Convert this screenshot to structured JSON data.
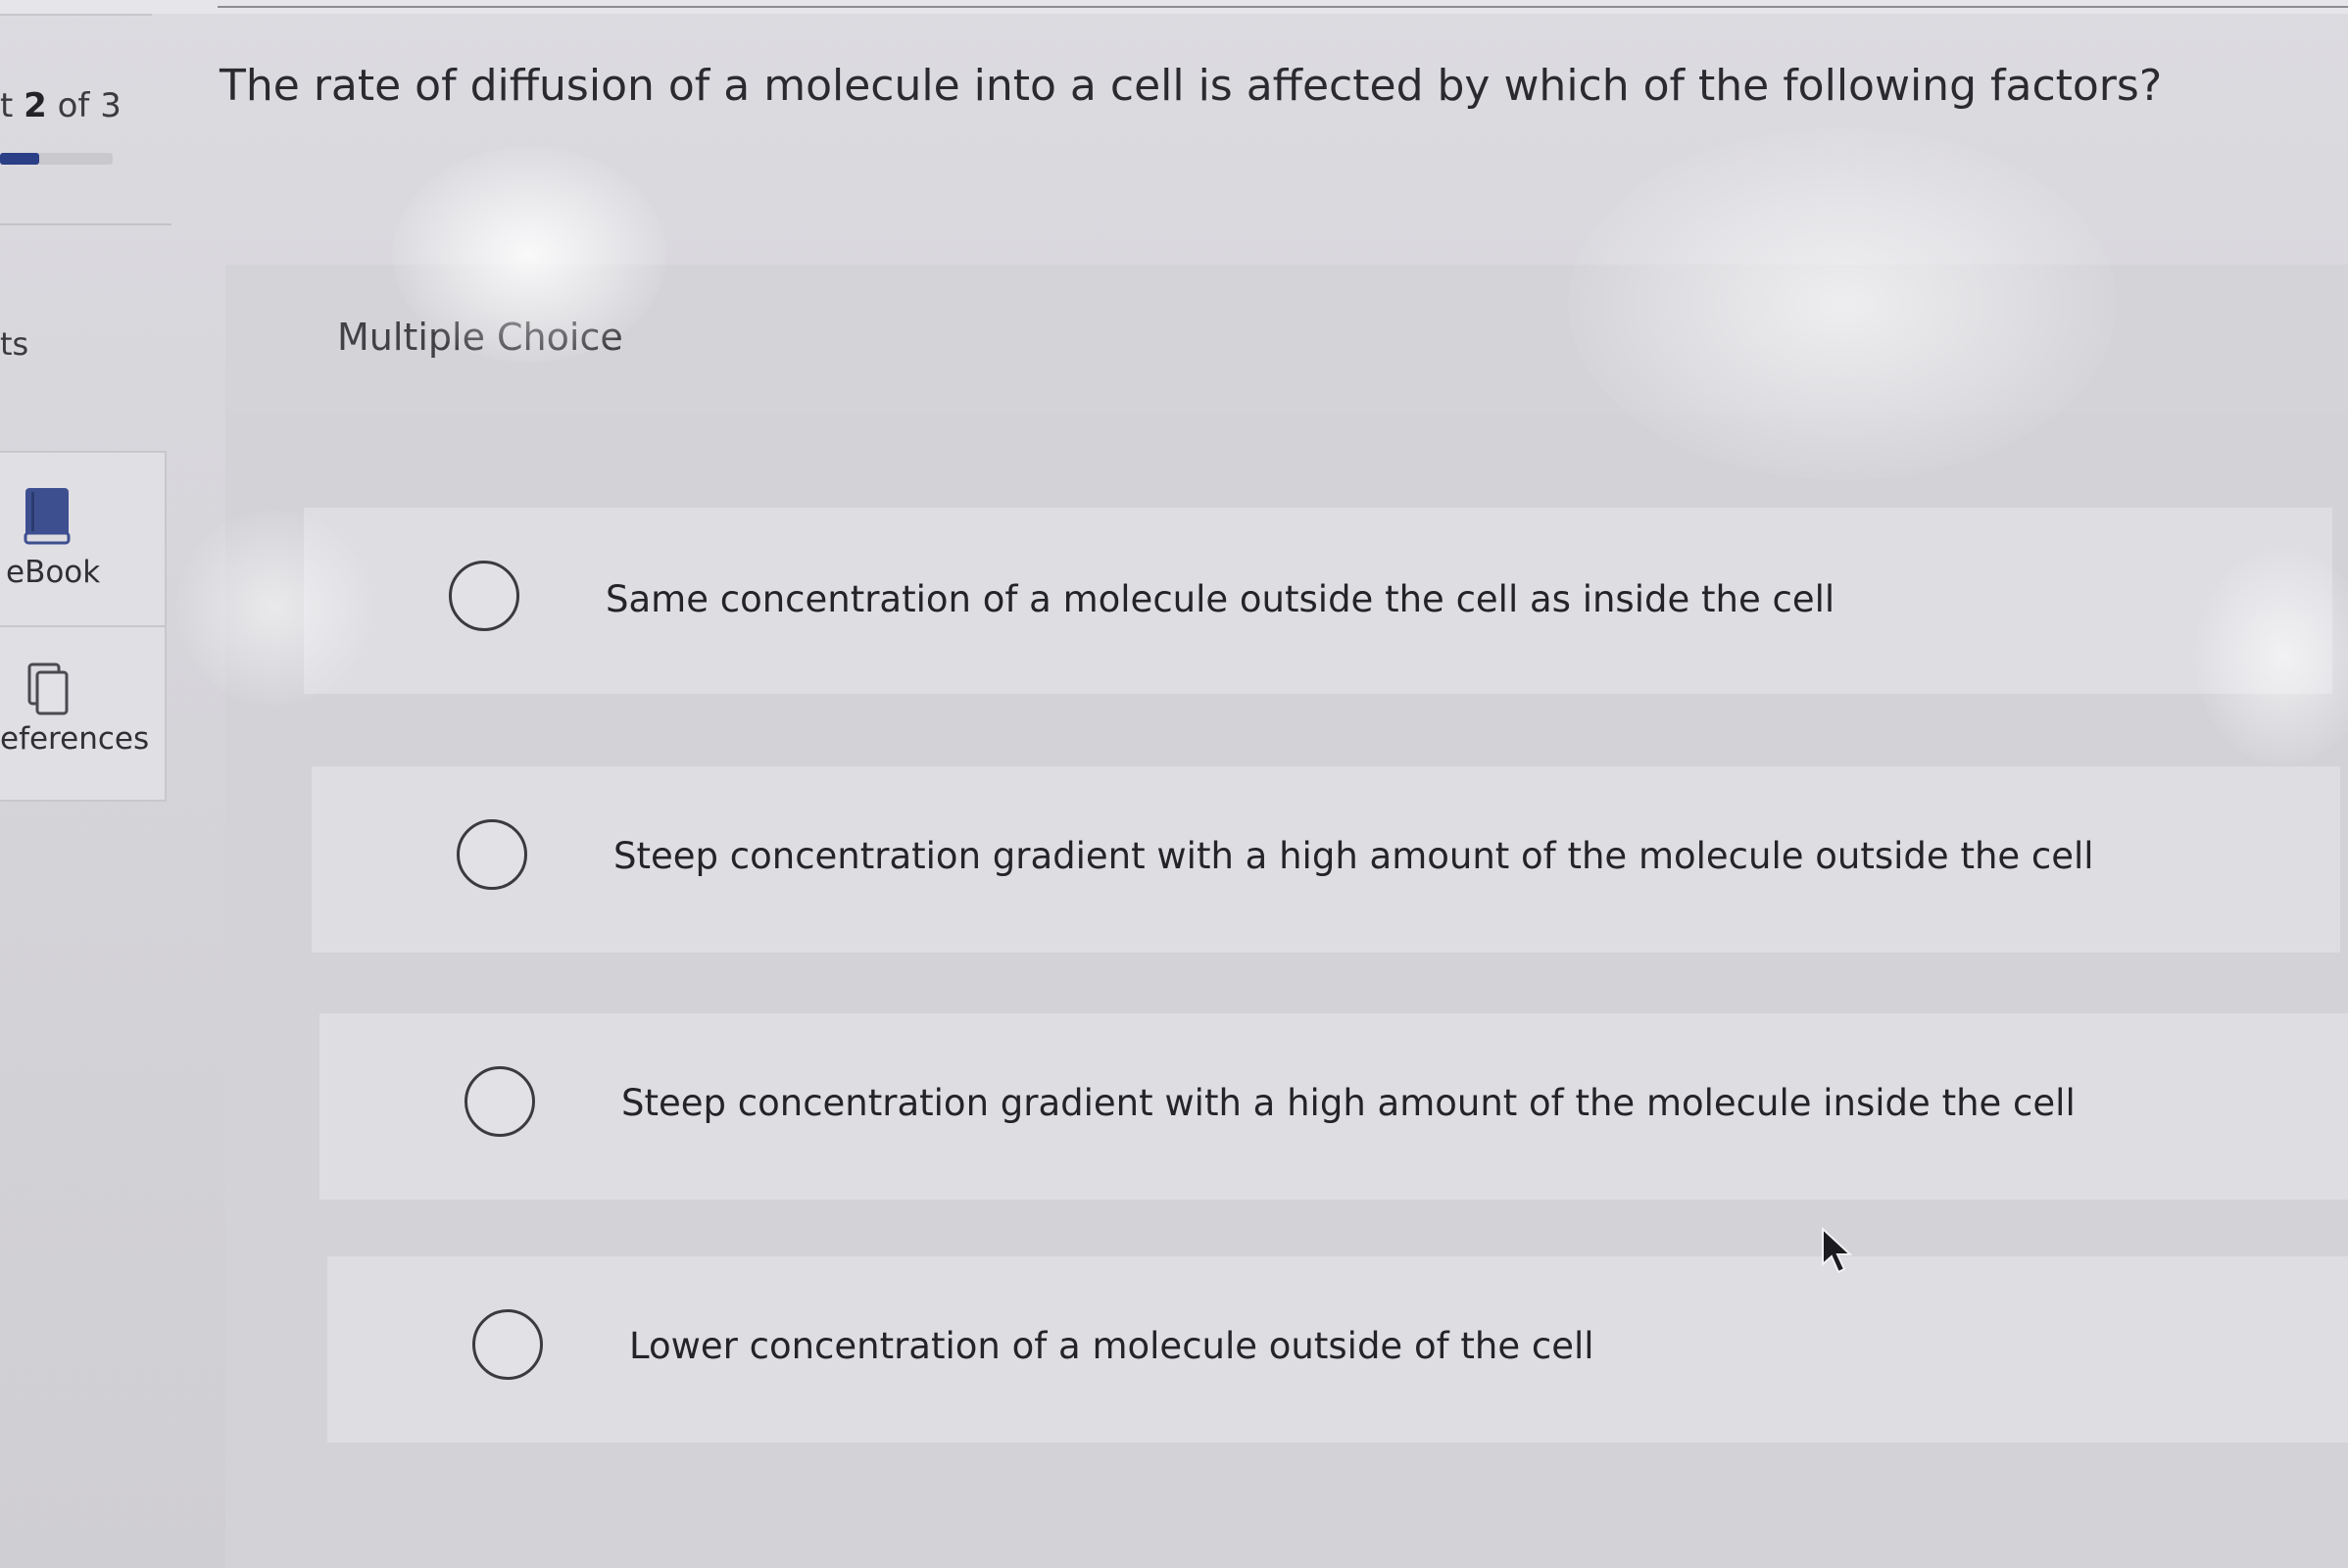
{
  "sidebar": {
    "progress_current": "2",
    "progress_rest": " of 3",
    "progress_prefix": "t ",
    "progress_fraction": 0.6667,
    "section_label": "ts",
    "tools": [
      {
        "label": "eBook",
        "icon": "book-icon"
      },
      {
        "label": "eferences",
        "icon": "copy-pages-icon"
      }
    ]
  },
  "question": {
    "text": "The rate of diffusion of a molecule into a cell is affected by which of the following factors?",
    "type_label": "Multiple Choice"
  },
  "options": [
    {
      "text": "Same concentration of a molecule outside the cell as inside the cell",
      "selected": false
    },
    {
      "text": "Steep concentration gradient with a high amount of the molecule outside the cell",
      "selected": false
    },
    {
      "text": "Steep concentration gradient with a high amount of the molecule inside the cell",
      "selected": false
    },
    {
      "text": "Lower concentration of a molecule outside of the cell",
      "selected": false
    }
  ],
  "colors": {
    "progress_fill": "#2b3f86",
    "ebook_icon": "#3d4f8f"
  }
}
